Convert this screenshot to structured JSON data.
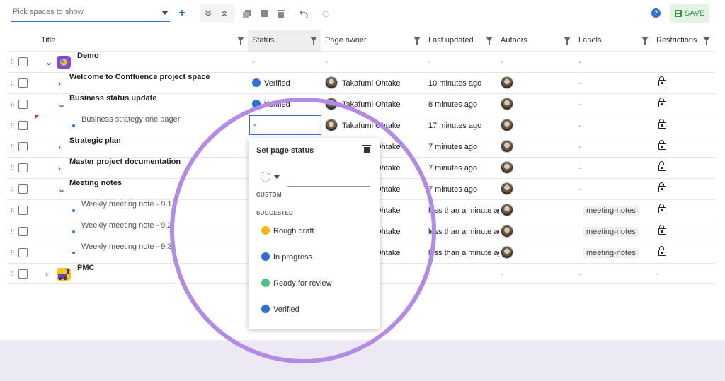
{
  "toolbar": {
    "space_picker_placeholder": "Pick spaces to show",
    "save_label": "SAVE"
  },
  "colors": {
    "accent": "#2a72d6",
    "verified": "#2a72d6",
    "rough_draft": "#f2b900",
    "in_progress": "#2a72d6",
    "ready_for_review": "#4cc08a",
    "highlight_ring": "#b38be6"
  },
  "columns": {
    "title": "Title",
    "status": "Status",
    "page_owner": "Page owner",
    "last_updated": "Last updated",
    "authors": "Authors",
    "labels": "Labels",
    "restrictions": "Restrictions"
  },
  "rows": [
    {
      "title": "Demo",
      "status": "-",
      "owner": "-",
      "updated": "-",
      "authors": "-",
      "labels": "-"
    },
    {
      "title": "Welcome to Confluence project space",
      "status": "Verified",
      "owner": "Takafumi Ohtake",
      "updated": "10 minutes ago",
      "labels": "-"
    },
    {
      "title": "Business status update",
      "status": "Verified",
      "owner": "Takafumi Ohtake",
      "updated": "8 minutes ago",
      "labels": "-"
    },
    {
      "title": "Business strategy one pager",
      "status": "-",
      "owner": "Takafumi Ohtake",
      "updated": "17 minutes ago",
      "labels": "-"
    },
    {
      "title": "Strategic plan",
      "owner": "Takafumi Ohtake",
      "updated": "7 minutes ago",
      "labels": "-"
    },
    {
      "title": "Master project documentation",
      "owner": "Takafumi Ohtake",
      "updated": "7 minutes ago",
      "labels": "-"
    },
    {
      "title": "Meeting notes",
      "owner": "Takafumi Ohtake",
      "updated": "7 minutes ago",
      "labels": "-"
    },
    {
      "title": "Weekly meeting note - 9.1",
      "owner": "Takafumi Ohtake",
      "updated": "less than a minute ag",
      "labels": "meeting-notes"
    },
    {
      "title": "Weekly meeting note - 9.2",
      "owner": "Takafumi Ohtake",
      "updated": "less than a minute ag",
      "labels": "meeting-notes"
    },
    {
      "title": "Weekly meeting note - 9.3",
      "owner": "Takafumi Ohtake",
      "updated": "less than a minute ag",
      "labels": "meeting-notes"
    },
    {
      "title": "PMC",
      "updated": "-",
      "authors": "-",
      "labels": "-",
      "restrictions": "-"
    }
  ],
  "popup": {
    "title": "Set page status",
    "custom_label": "CUSTOM",
    "suggested_label": "SUGGESTED",
    "options": [
      "Rough draft",
      "In progress",
      "Ready for review",
      "Verified"
    ]
  }
}
